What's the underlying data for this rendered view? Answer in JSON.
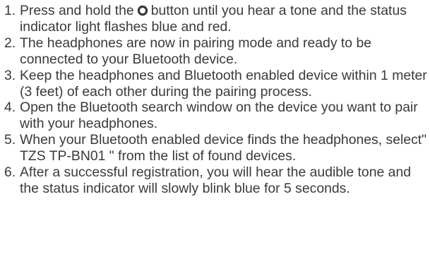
{
  "steps": [
    {
      "number": "1.",
      "before_icon": "Press and hold the",
      "icon": "power-button-icon",
      "after_icon": "button until you hear a tone and the status indicator light flashes blue and red."
    },
    {
      "number": "2.",
      "text": "The headphones are now in pairing mode and ready to be connected to your Bluetooth device."
    },
    {
      "number": "3.",
      "text": "Keep the headphones and Bluetooth enabled device within 1 meter (3 feet) of each other during the pairing process."
    },
    {
      "number": "4.",
      "text": "Open the Bluetooth search window on the device you want to pair with your headphones."
    },
    {
      "number": "5.",
      "text": "When your Bluetooth enabled device finds the headphones, select\" TZS TP-BN01 \" from the list of found devices."
    },
    {
      "number": "6.",
      "text": "After a successful registration, you will hear the audible tone and the status indicator will slowly blink blue for 5 seconds."
    }
  ],
  "colors": {
    "text": "#3a3a3a",
    "background": "#ffffff"
  }
}
